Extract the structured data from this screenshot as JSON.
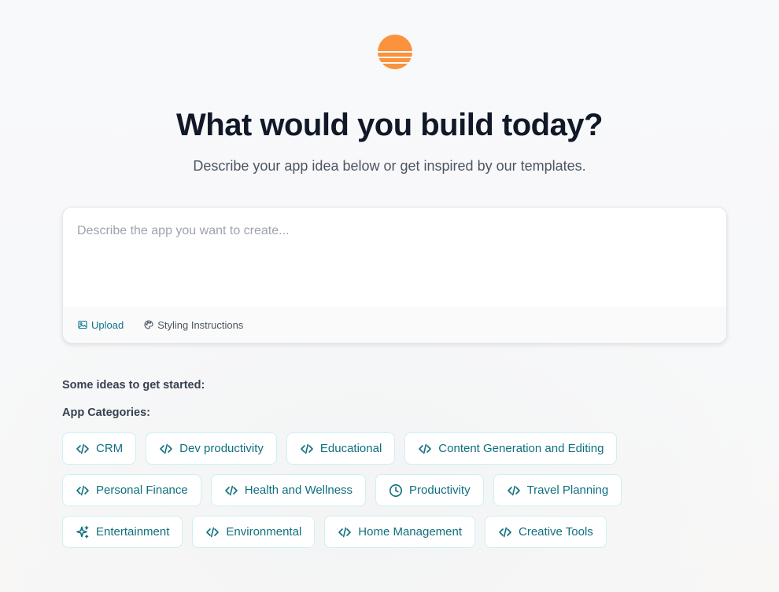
{
  "brand": {
    "logo_icon": "sunset-logo-icon",
    "logo_color": "#FB923C"
  },
  "hero": {
    "title": "What would you build today?",
    "subtitle": "Describe your app idea below or get inspired by our templates."
  },
  "prompt": {
    "placeholder": "Describe the app you want to create...",
    "value": "",
    "upload_label": "Upload",
    "upload_icon": "image-icon",
    "styling_label": "Styling Instructions",
    "styling_icon": "palette-icon"
  },
  "ideas": {
    "heading": "Some ideas to get started:",
    "categories_heading": "App Categories:",
    "rows": [
      [
        {
          "label": "CRM",
          "icon": "code-icon"
        },
        {
          "label": "Dev productivity",
          "icon": "code-icon"
        },
        {
          "label": "Educational",
          "icon": "code-icon"
        },
        {
          "label": "Content Generation and Editing",
          "icon": "code-icon"
        }
      ],
      [
        {
          "label": "Personal Finance",
          "icon": "code-icon"
        },
        {
          "label": "Health and Wellness",
          "icon": "code-icon"
        },
        {
          "label": "Productivity",
          "icon": "clock-icon"
        },
        {
          "label": "Travel Planning",
          "icon": "code-icon"
        }
      ],
      [
        {
          "label": "Entertainment",
          "icon": "sparkles-icon"
        },
        {
          "label": "Environmental",
          "icon": "code-icon"
        },
        {
          "label": "Home Management",
          "icon": "code-icon"
        },
        {
          "label": "Creative Tools",
          "icon": "code-icon"
        }
      ]
    ]
  },
  "colors": {
    "accent": "#0F6F7F",
    "chip_border": "#CDF0F3",
    "title": "#111827"
  }
}
